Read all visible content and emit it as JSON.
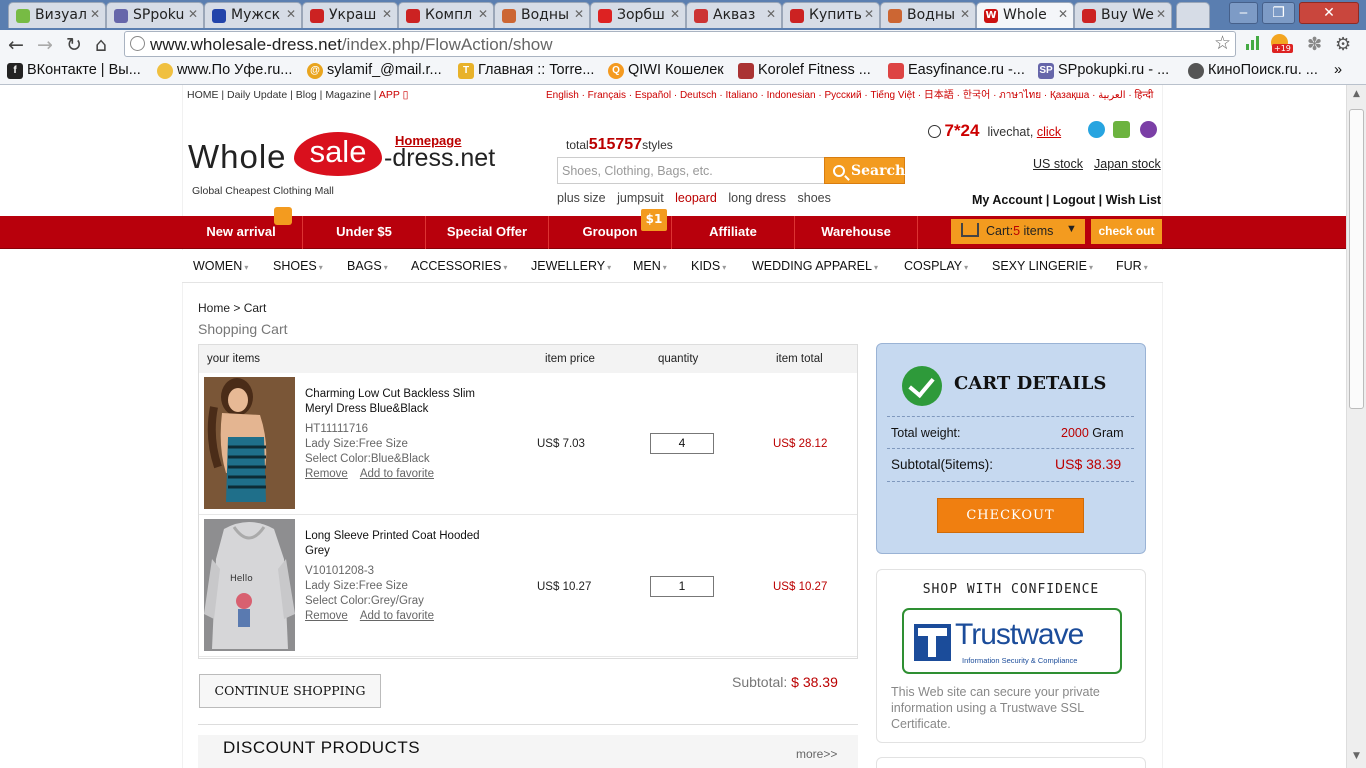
{
  "browser": {
    "tabs": [
      {
        "title": "Визуал",
        "color": "#7b4"
      },
      {
        "title": "SPpoku",
        "color": "#66a"
      },
      {
        "title": "Мужск",
        "color": "#24a"
      },
      {
        "title": "Украш",
        "color": "#c22"
      },
      {
        "title": "Компл",
        "color": "#c22"
      },
      {
        "title": "Водны",
        "color": "#c63"
      },
      {
        "title": "Зорбш",
        "color": "#d22"
      },
      {
        "title": "Акваз",
        "color": "#c33"
      },
      {
        "title": "Купить",
        "color": "#c22"
      },
      {
        "title": "Водны",
        "color": "#c63"
      },
      {
        "title": "Whole",
        "color": "#c11"
      },
      {
        "title": "Buy We",
        "color": "#c22"
      }
    ],
    "active_tab_index": 10,
    "url_host": "www.wholesale-dress.net",
    "url_path": "/index.php/FlowAction/show",
    "notif_badge": "+19",
    "bookmarks": [
      {
        "label": "ВКонтакте | Вы...",
        "icon": "vk-icon"
      },
      {
        "label": "www.По Уфе.ru...",
        "icon": "ufa-icon"
      },
      {
        "label": "sylamif_@mail.r...",
        "icon": "mail-icon"
      },
      {
        "label": "Главная :: Torre...",
        "icon": "torrent-icon"
      },
      {
        "label": "QIWI Кошелек",
        "icon": "qiwi-icon"
      },
      {
        "label": "Korolef Fitness ...",
        "icon": "fitness-icon"
      },
      {
        "label": "Easyfinance.ru -...",
        "icon": "finance-icon"
      },
      {
        "label": "SPpokupki.ru - ...",
        "icon": "sp-icon"
      },
      {
        "label": "КиноПоиск.ru. ...",
        "icon": "kinopoisk-icon"
      }
    ]
  },
  "site": {
    "top_links": "HOME | Daily Update | Blog | Magazine |",
    "app_label": "APP",
    "languages": "English · Français · Español · Deutsch · Italiano · Indonesian · Русский · Tiếng Việt · 日本語 · 한국어 · ภาษาไทย · Қазақша · العربية · हिन्दी",
    "logo_whole": "Whole",
    "logo_sale": "sale",
    "logo_dress": "-dress.net",
    "tagline": "Global Cheapest Clothing Mall",
    "homepage_link": "Homepage",
    "total_prefix": "total",
    "total_styles": "515757",
    "total_suffix": "styles",
    "search_placeholder": "Shoes, Clothing, Bags, etc.",
    "search_button": "Search",
    "hot_searches": [
      "plus size",
      "jumpsuit",
      "leopard",
      "long dress",
      "shoes"
    ],
    "support_hours": "7*24",
    "livechat_label": "livechat,",
    "livechat_click": "click",
    "us_stock": "US stock",
    "japan_stock": "Japan stock",
    "account_links": [
      "My Account",
      "Logout",
      "Wish List"
    ],
    "main_nav": [
      "New arrival",
      "Under $5",
      "Special Offer",
      "Groupon",
      "Affiliate",
      "Warehouse"
    ],
    "groupon_badge": "$1",
    "cart_widget": {
      "prefix": "Cart:",
      "count": "5",
      "unit": "items"
    },
    "checkout_top": "check out",
    "categories": [
      "WOMEN",
      "SHOES",
      "BAGS",
      "ACCESSORIES",
      "JEWELLERY",
      "MEN",
      "KIDS",
      "WEDDING APPAREL",
      "COSPLAY",
      "SEXY LINGERIE",
      "FUR"
    ]
  },
  "cart": {
    "breadcrumb_home": "Home",
    "breadcrumb_sep": ">",
    "breadcrumb_current": "Cart",
    "title": "Shopping Cart",
    "headers": {
      "items": "your items",
      "price": "item price",
      "quantity": "quantity",
      "total": "item total"
    },
    "items": [
      {
        "name": "Charming Low Cut Backless Slim Meryl Dress Blue&Black",
        "sku": "HT11111716",
        "size": "Lady Size:Free Size",
        "color": "Select Color:Blue&Black",
        "price": "US$ 7.03",
        "quantity": "4",
        "total": "US$ 28.12"
      },
      {
        "name": "Long Sleeve Printed Coat Hooded Grey",
        "sku": "V10101208-3",
        "size": "Lady Size:Free Size",
        "color": "Select Color:Grey/Gray",
        "price": "US$ 10.27",
        "quantity": "1",
        "total": "US$ 10.27"
      }
    ],
    "remove_label": "Remove",
    "favorite_label": "Add to favorite",
    "continue_button": "CONTINUE SHOPPING",
    "subtotal_label": "Subtotal:",
    "subtotal_value": "$ 38.39",
    "discount_title": "DISCOUNT PRODUCTS",
    "more_link": "more>>"
  },
  "details": {
    "title": "CART DETAILS",
    "weight_label": "Total weight:",
    "weight_value": "2000",
    "weight_unit": "Gram",
    "subtotal_label": "Subtotal(5items):",
    "subtotal_value": "US$ 38.39",
    "checkout_button": "CHECKOUT"
  },
  "confidence": {
    "title": "SHOP WITH CONFIDENCE",
    "brand": "Trustwave",
    "brand_sub": "Information Security & Compliance",
    "text": "This Web site can secure your private information using a Trustwave SSL Certificate."
  }
}
